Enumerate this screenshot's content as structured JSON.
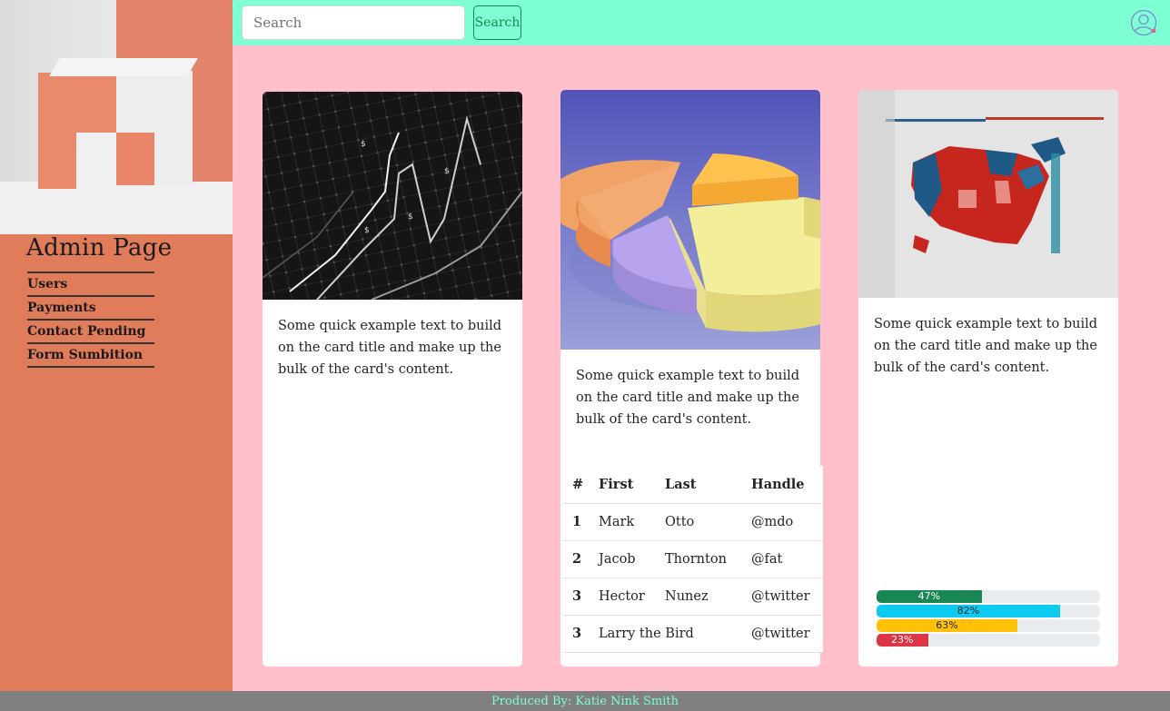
{
  "sidebar": {
    "title": "Admin Page",
    "items": [
      {
        "label": "Users"
      },
      {
        "label": "Payments"
      },
      {
        "label": "Contact Pending"
      },
      {
        "label": "Form Sumbition"
      }
    ]
  },
  "header": {
    "search_placeholder": "Search",
    "search_button": "Search",
    "avatar_icon": "user-circle-icon"
  },
  "cards": [
    {
      "text": "Some quick example text to build on the card title and make up the bulk of the card's content.",
      "image": "stock-chart-grid"
    },
    {
      "text": "Some quick example text to build on the card title and make up the bulk of the card's content.",
      "image": "3d-pie-chart"
    },
    {
      "text": "Some quick example text to build on the card title and make up the bulk of the card's content.",
      "image": "us-election-map"
    }
  ],
  "table": {
    "headers": [
      "#",
      "First",
      "Last",
      "Handle"
    ],
    "rows": [
      [
        "1",
        "Mark",
        "Otto",
        "@mdo"
      ],
      [
        "2",
        "Jacob",
        "Thornton",
        "@fat"
      ],
      [
        "3",
        "Hector",
        "Nunez",
        "@twitter"
      ],
      [
        "3",
        "Larry the Bird",
        "",
        "@twitter"
      ]
    ]
  },
  "progress": [
    {
      "label": "47%",
      "value": 0.47,
      "color": "#198754",
      "text_color": "#ffffff"
    },
    {
      "label": "82%",
      "value": 0.82,
      "color": "#0dcaf0",
      "text_color": "#212529"
    },
    {
      "label": "63%",
      "value": 0.63,
      "color": "#ffc107",
      "text_color": "#212529"
    },
    {
      "label": "23%",
      "value": 0.23,
      "color": "#dc3545",
      "text_color": "#ffffff"
    }
  ],
  "footer": {
    "text": "Produced By: Katie Nink Smith"
  },
  "colors": {
    "sidebar": "#e07c5a",
    "header": "#7fffd4",
    "page": "#ffc0cb",
    "footer": "#808080"
  }
}
